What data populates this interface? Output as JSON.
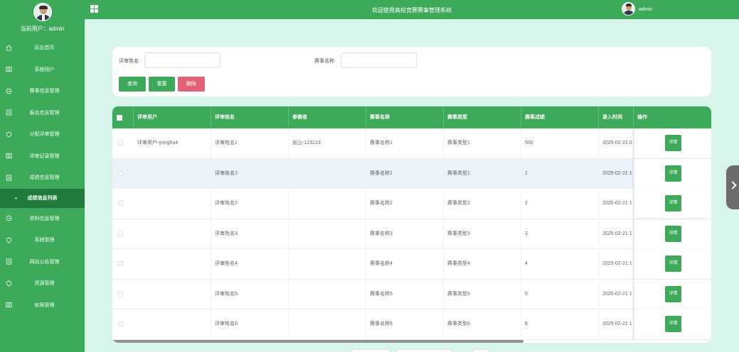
{
  "header": {
    "title": "欢迎使用高校竞赛赛事管理系统",
    "username": "admin"
  },
  "sidebar": {
    "current_user": "当前用户：admin",
    "items": [
      {
        "label": "后台首页",
        "icon": "home-icon"
      },
      {
        "label": "系统用户",
        "icon": "columns-icon"
      },
      {
        "label": "赛事信息管理",
        "icon": "chat-icon"
      },
      {
        "label": "报名信息管理",
        "icon": "document-icon"
      },
      {
        "label": "分配评审管理",
        "icon": "shield-icon"
      },
      {
        "label": "评审记录管理",
        "icon": "columns-icon"
      },
      {
        "label": "成绩信息管理",
        "icon": "document-icon"
      },
      {
        "label": "成绩信息列表",
        "icon": "plus-icon"
      },
      {
        "label": "资料信息管理",
        "icon": "chat-icon"
      },
      {
        "label": "系统管理",
        "icon": "shield-icon"
      },
      {
        "label": "网站公告管理",
        "icon": "document-icon"
      },
      {
        "label": "资源管理",
        "icon": "shield-icon"
      },
      {
        "label": "权限管理",
        "icon": "columns-icon"
      }
    ]
  },
  "search": {
    "label_reviewer_name": "评审姓名",
    "label_event_name": "赛事名称",
    "reviewer_name_value": "",
    "event_name_value": "",
    "query_label": "查询",
    "reset_label": "重置",
    "delete_label": "删除"
  },
  "table": {
    "headers": [
      "评审用户",
      "评审姓名",
      "参赛者",
      "赛事名称",
      "赛事类型",
      "赛事成绩",
      "录入时间",
      "操作"
    ],
    "detail_label": "详情",
    "rows": [
      [
        "评审用户-yonghu4",
        "评审姓名1",
        "张山-123123",
        "赛事名称1",
        "赛事类型1",
        "500",
        "2025-02-22 0"
      ],
      [
        "",
        "评审姓名1",
        "",
        "赛事名称1",
        "赛事类型1",
        "1",
        "2025-02-21 1"
      ],
      [
        "",
        "评审姓名2",
        "",
        "赛事名称2",
        "赛事类型2",
        "2",
        "2025-02-21 1"
      ],
      [
        "",
        "评审姓名3",
        "",
        "赛事名称3",
        "赛事类型3",
        "3",
        "2025-02-21 1"
      ],
      [
        "",
        "评审姓名4",
        "",
        "赛事名称4",
        "赛事类型4",
        "4",
        "2025-02-21 1"
      ],
      [
        "",
        "评审姓名5",
        "",
        "赛事名称5",
        "赛事类型5",
        "5",
        "2025-02-21 1"
      ],
      [
        "",
        "评审姓名6",
        "",
        "赛事名称6",
        "赛事类型6",
        "6",
        "2025-02-21 1"
      ]
    ]
  },
  "colors": {
    "primary": "#3daa5a",
    "danger": "#e06275",
    "active_menu": "#1f7a3b",
    "page_bg": "#d8f5ec"
  }
}
